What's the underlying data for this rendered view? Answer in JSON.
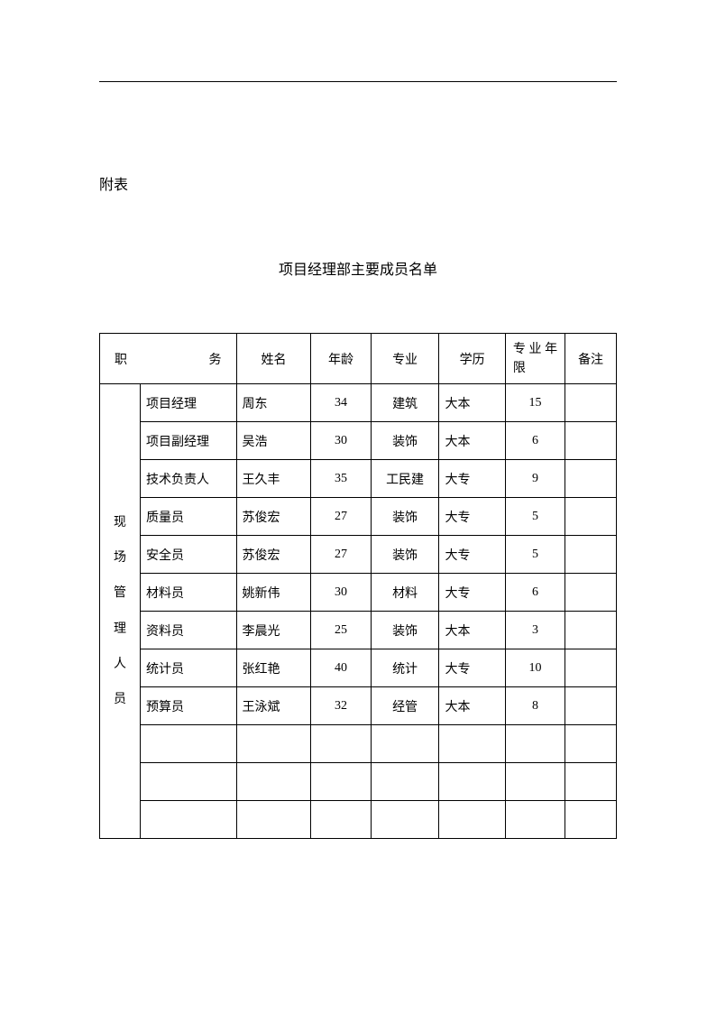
{
  "appendix_label": "附表",
  "title": "项目经理部主要成员名单",
  "headers": {
    "job": "职务",
    "name": "姓名",
    "age": "年龄",
    "major": "专业",
    "degree": "学历",
    "years": "专业年限",
    "note": "备注"
  },
  "category_label": "现场管理人员",
  "rows": [
    {
      "role": "项目经理",
      "name": "周东",
      "age": "34",
      "major": "建筑",
      "degree": "大本",
      "years": "15",
      "note": ""
    },
    {
      "role": "项目副经理",
      "name": "吴浩",
      "age": "30",
      "major": "装饰",
      "degree": "大本",
      "years": "6",
      "note": ""
    },
    {
      "role": "技术负责人",
      "name": "王久丰",
      "age": "35",
      "major": "工民建",
      "degree": "大专",
      "years": "9",
      "note": ""
    },
    {
      "role": "质量员",
      "name": "苏俊宏",
      "age": "27",
      "major": "装饰",
      "degree": "大专",
      "years": "5",
      "note": ""
    },
    {
      "role": "安全员",
      "name": "苏俊宏",
      "age": "27",
      "major": "装饰",
      "degree": "大专",
      "years": "5",
      "note": ""
    },
    {
      "role": "材料员",
      "name": "姚新伟",
      "age": "30",
      "major": "材料",
      "degree": "大专",
      "years": "6",
      "note": ""
    },
    {
      "role": "资料员",
      "name": "李晨光",
      "age": "25",
      "major": "装饰",
      "degree": "大本",
      "years": "3",
      "note": ""
    },
    {
      "role": "统计员",
      "name": "张红艳",
      "age": "40",
      "major": "统计",
      "degree": "大专",
      "years": "10",
      "note": ""
    },
    {
      "role": "预算员",
      "name": "王泳斌",
      "age": "32",
      "major": "经管",
      "degree": "大本",
      "years": "8",
      "note": ""
    },
    {
      "role": "",
      "name": "",
      "age": "",
      "major": "",
      "degree": "",
      "years": "",
      "note": ""
    },
    {
      "role": "",
      "name": "",
      "age": "",
      "major": "",
      "degree": "",
      "years": "",
      "note": ""
    },
    {
      "role": "",
      "name": "",
      "age": "",
      "major": "",
      "degree": "",
      "years": "",
      "note": ""
    }
  ]
}
